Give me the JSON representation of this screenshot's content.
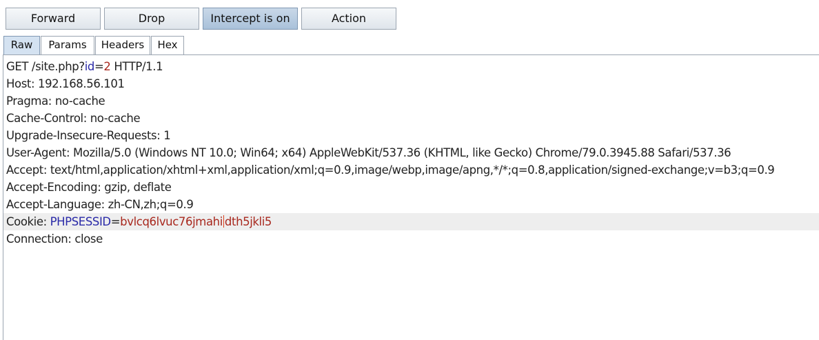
{
  "toolbar": {
    "forward_label": "Forward",
    "drop_label": "Drop",
    "intercept_label": "Intercept is on",
    "action_label": "Action"
  },
  "tabs": [
    {
      "label": "Raw",
      "active": true
    },
    {
      "label": "Params",
      "active": false
    },
    {
      "label": "Headers",
      "active": false
    },
    {
      "label": "Hex",
      "active": false
    }
  ],
  "request": {
    "line1": {
      "method": "GET /site.php?",
      "param_name": "id",
      "equals": "=",
      "param_value": "2",
      "version": " HTTP/1.1"
    },
    "host": "Host: 192.168.56.101",
    "pragma": "Pragma: no-cache",
    "cache_control": "Cache-Control: no-cache",
    "upgrade_insecure": "Upgrade-Insecure-Requests: 1",
    "user_agent": "User-Agent: Mozilla/5.0 (Windows NT 10.0; Win64; x64) AppleWebKit/537.36 (KHTML, like Gecko) Chrome/79.0.3945.88 Safari/537.36",
    "accept": "Accept: text/html,application/xhtml+xml,application/xml;q=0.9,image/webp,image/apng,*/*;q=0.8,application/signed-exchange;v=b3;q=0.9",
    "accept_encoding": "Accept-Encoding: gzip, deflate",
    "accept_language": "Accept-Language: zh-CN,zh;q=0.9",
    "cookie": {
      "prefix": "Cookie: ",
      "name": "PHPSESSID",
      "equals": "=",
      "value_before_caret": "bvlcq6lvuc76jmahi",
      "value_after_caret": "dth5jkli5"
    },
    "connection": "Connection: close"
  },
  "colors": {
    "param_name": "#2a2aa8",
    "param_value": "#a8281e",
    "active_tab": "#d4e2f1",
    "intercept_on": "#b8cde3"
  }
}
